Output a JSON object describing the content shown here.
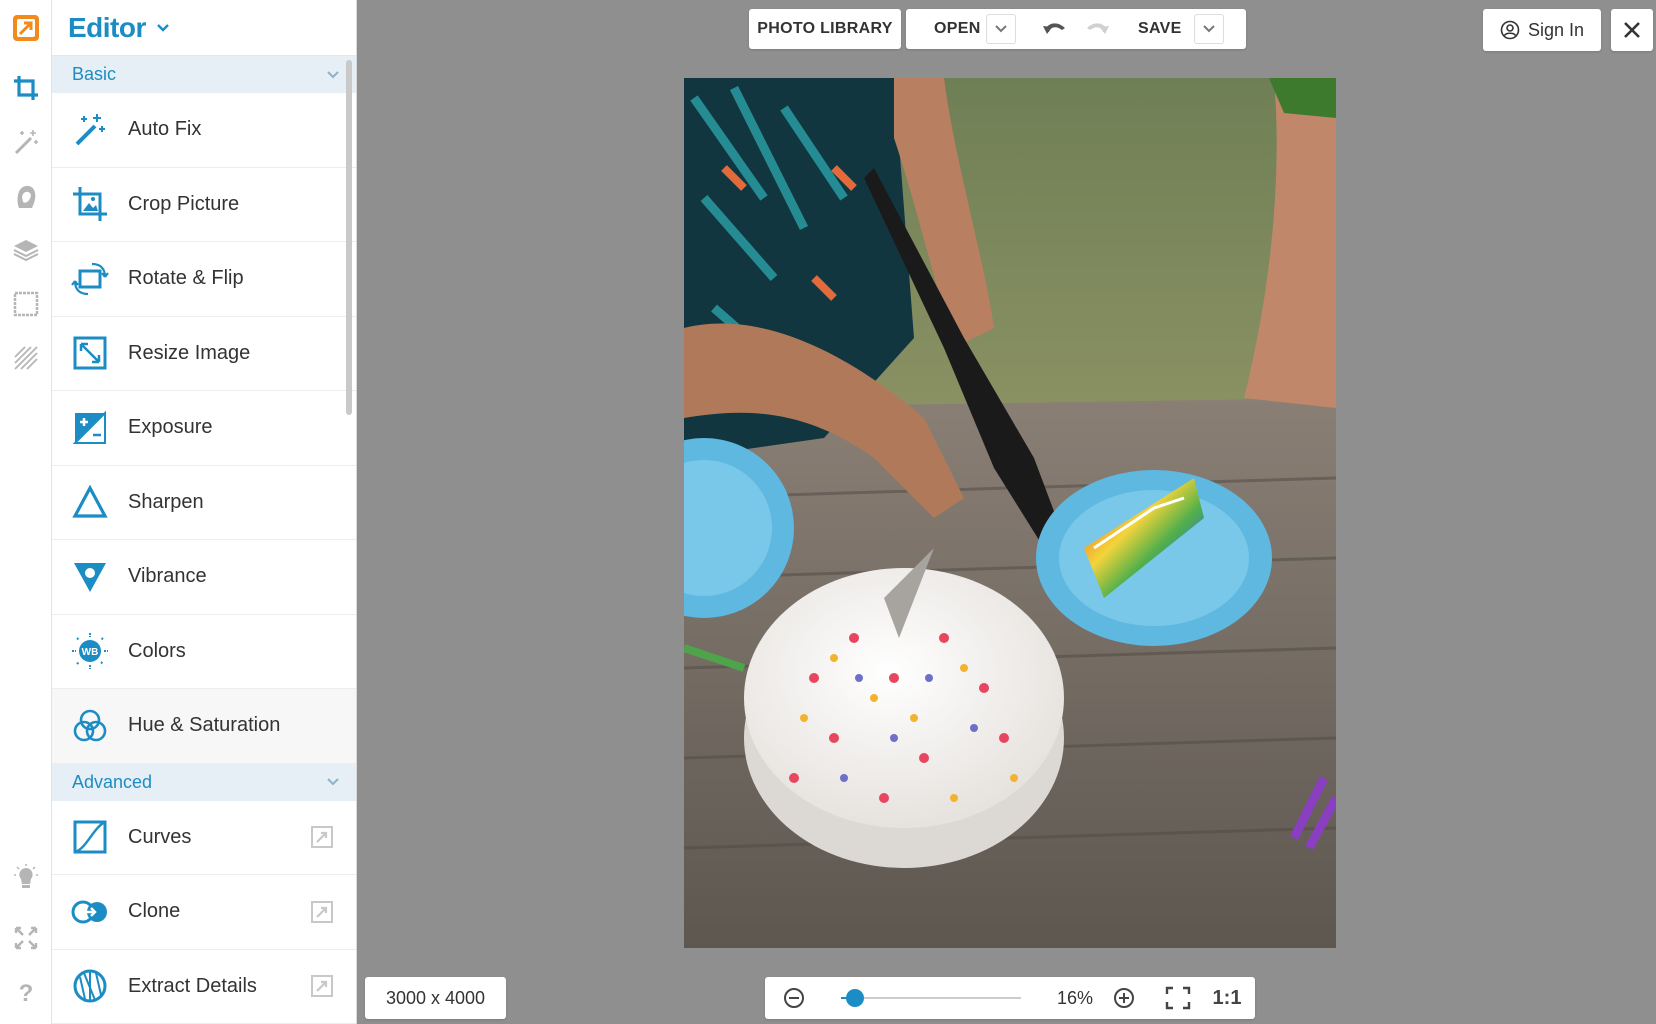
{
  "app": {
    "title": "Editor"
  },
  "rail": {
    "items": [
      {
        "name": "crop-tools-icon"
      },
      {
        "name": "magic-wand-icon"
      },
      {
        "name": "portrait-icon"
      },
      {
        "name": "layers-icon"
      },
      {
        "name": "frame-icon"
      },
      {
        "name": "texture-icon"
      },
      {
        "name": "lightbulb-icon"
      },
      {
        "name": "fullscreen-icon"
      },
      {
        "name": "help-icon"
      }
    ],
    "help_label": "?"
  },
  "sections": {
    "basic": "Basic",
    "advanced": "Advanced"
  },
  "basic_tools": [
    {
      "label": "Auto Fix",
      "icon": "magic-wand-icon"
    },
    {
      "label": "Crop Picture",
      "icon": "crop-icon"
    },
    {
      "label": "Rotate & Flip",
      "icon": "rotate-icon"
    },
    {
      "label": "Resize Image",
      "icon": "resize-icon"
    },
    {
      "label": "Exposure",
      "icon": "exposure-icon"
    },
    {
      "label": "Sharpen",
      "icon": "sharpen-icon"
    },
    {
      "label": "Vibrance",
      "icon": "vibrance-icon"
    },
    {
      "label": "Colors",
      "icon": "white-balance-icon",
      "badge": "WB"
    },
    {
      "label": "Hue & Saturation",
      "icon": "hue-saturation-icon"
    }
  ],
  "advanced_tools": [
    {
      "label": "Curves",
      "icon": "curves-icon",
      "pro": true
    },
    {
      "label": "Clone",
      "icon": "clone-icon",
      "pro": true
    },
    {
      "label": "Extract Details",
      "icon": "extract-details-icon",
      "pro": true
    }
  ],
  "toolbar": {
    "photo_library": "PHOTO LIBRARY",
    "open": "OPEN",
    "save": "SAVE",
    "sign_in": "Sign In"
  },
  "status": {
    "dimensions": "3000 x 4000",
    "zoom": "16%",
    "zoom_fraction": 0.08,
    "actual_size": "1:1"
  },
  "colors": {
    "accent": "#1c8cc4",
    "section_bg": "#e6eff5",
    "workspace": "#8f8f8f"
  }
}
